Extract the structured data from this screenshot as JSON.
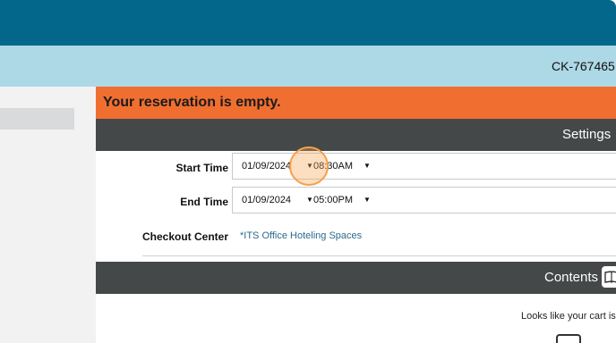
{
  "header": {
    "order_id": "CK-767465"
  },
  "alert": {
    "message": "Your reservation is empty."
  },
  "settings": {
    "title": "Settings",
    "start_time": {
      "label": "Start Time",
      "date": "01/09/2024",
      "time": "08:30AM"
    },
    "end_time": {
      "label": "End Time",
      "date": "01/09/2024",
      "time": "05:00PM"
    },
    "checkout_center": {
      "label": "Checkout Center",
      "value": "*ITS Office Hoteling Spaces"
    }
  },
  "contents": {
    "title": "Contents",
    "icon": "book-icon",
    "empty_message": "Looks like your cart is",
    "cart_icon": "cart-icon"
  },
  "colors": {
    "topbar": "#02678b",
    "subbar": "#add8e6",
    "alert": "#f06f30",
    "section_header": "#454849",
    "link": "#2b6a8c",
    "click_marker": "#f5a04c"
  }
}
